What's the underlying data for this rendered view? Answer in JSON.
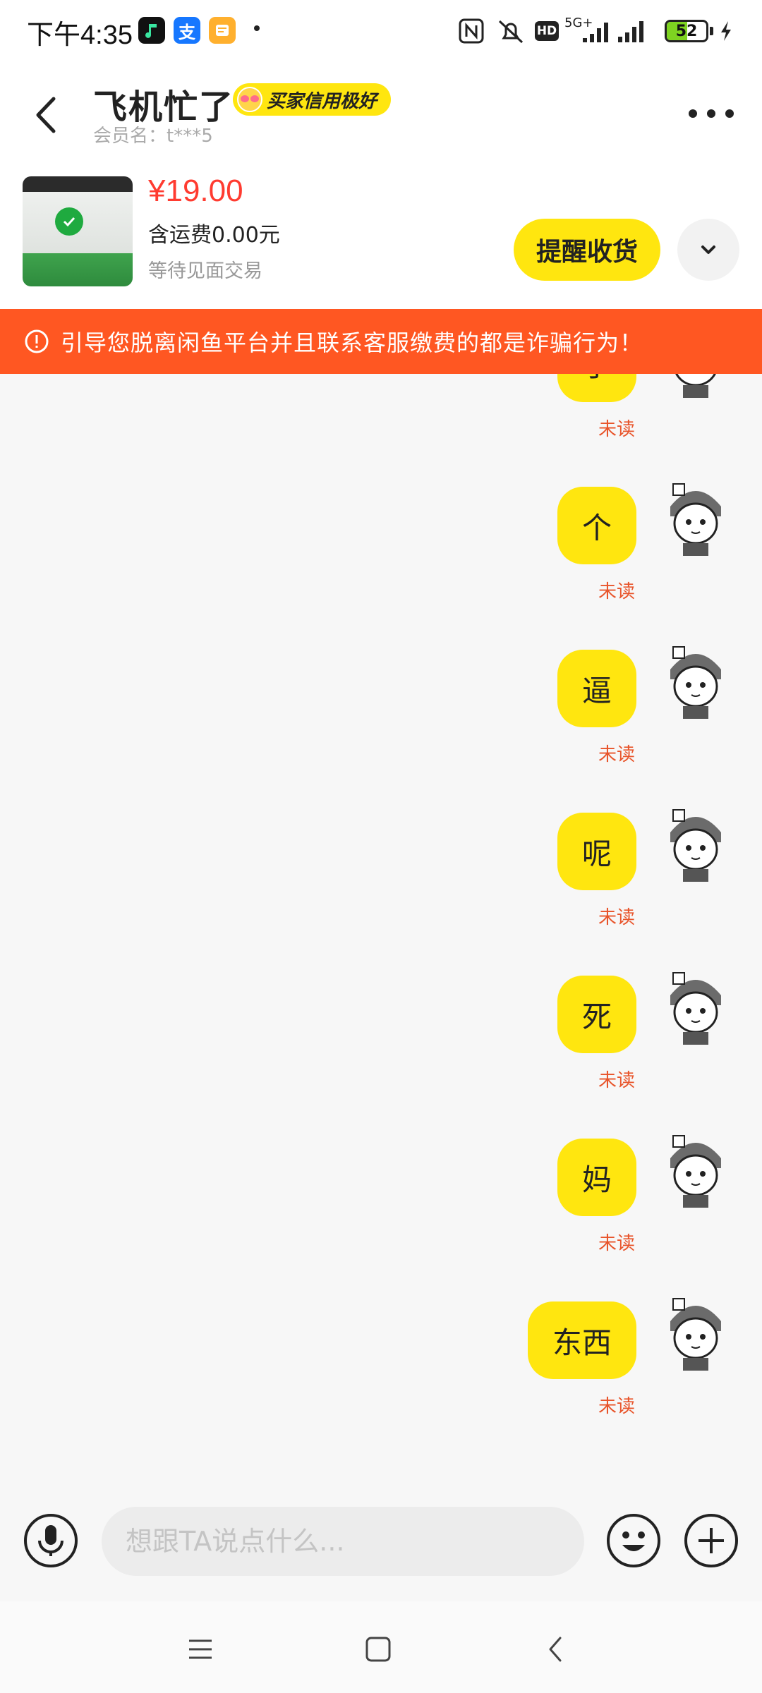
{
  "status_bar": {
    "time": "下午4:35",
    "app_icons": [
      "music-app-icon",
      "alipay-icon",
      "notes-app-icon"
    ],
    "alipay_glyph": "支",
    "network": "5G+",
    "hd": "HD",
    "battery": "52"
  },
  "header": {
    "title": "飞机忙了",
    "credit_badge": "买家信用极好",
    "member_name": "会员名：t***5"
  },
  "product": {
    "price": "¥19.00",
    "shipping": "含运费0.00元",
    "status": "等待见面交易",
    "remind_button": "提醒收货"
  },
  "warning": {
    "text": "引导您脱离闲鱼平台并且联系客服缴费的都是诈骗行为！"
  },
  "messages": [
    {
      "text": "了",
      "status": "未读"
    },
    {
      "text": "个",
      "status": "未读"
    },
    {
      "text": "逼",
      "status": "未读"
    },
    {
      "text": "呢",
      "status": "未读"
    },
    {
      "text": "死",
      "status": "未读"
    },
    {
      "text": "妈",
      "status": "未读"
    },
    {
      "text": "东西",
      "status": "未读"
    }
  ],
  "input": {
    "placeholder": "想跟TA说点什么..."
  },
  "colors": {
    "accent": "#ffe60f",
    "warning": "#ff5722",
    "price": "#ff3b30",
    "unread": "#e8542a"
  }
}
